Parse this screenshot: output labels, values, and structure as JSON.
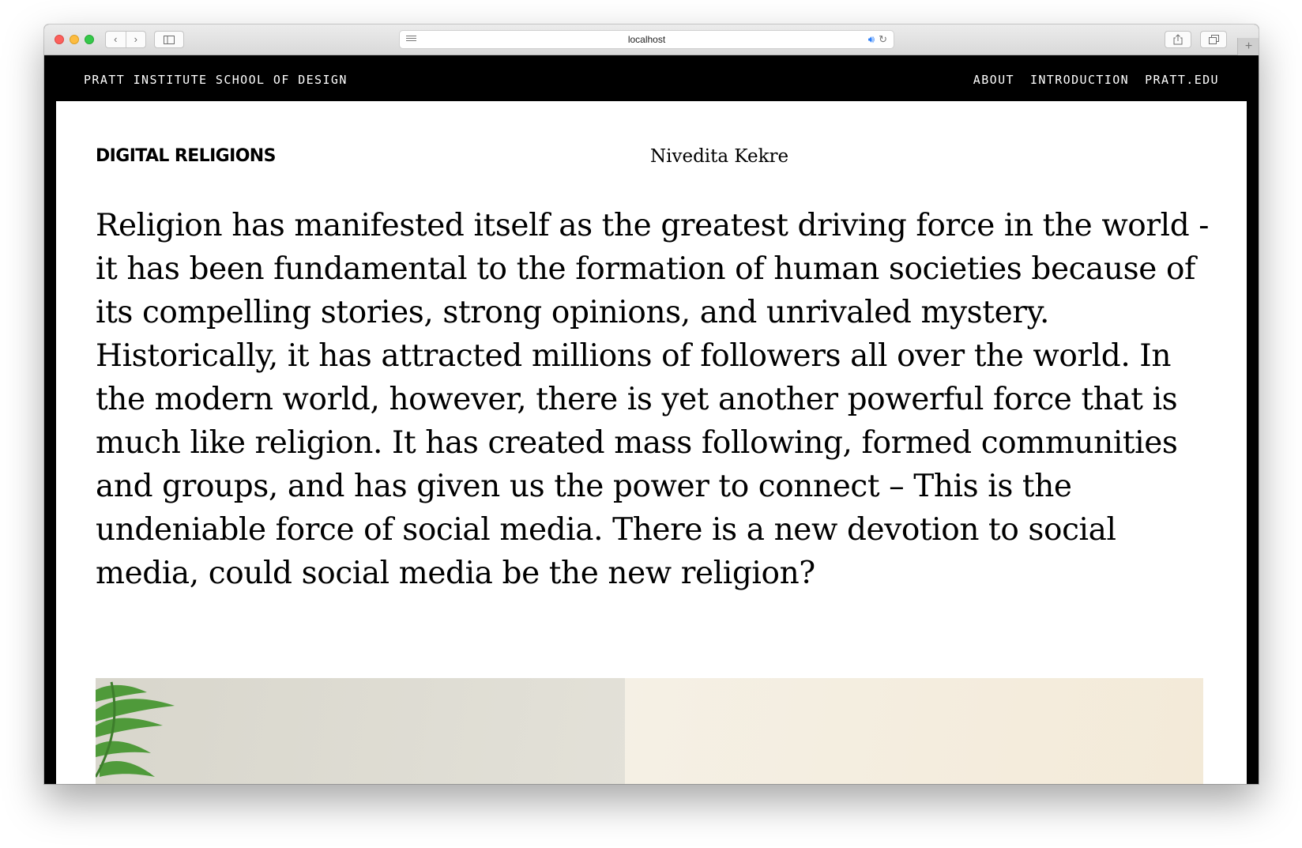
{
  "browser": {
    "url": "localhost",
    "icons": {
      "back": "chevron-left-icon",
      "forward": "chevron-right-icon",
      "sidebar": "sidebar-icon",
      "reader": "reader-icon",
      "audio": "speaker-icon",
      "reload": "reload-icon",
      "share": "share-icon",
      "tabs": "tabs-icon",
      "new_tab": "plus-icon"
    }
  },
  "header": {
    "site_title": "PRATT INSTITUTE SCHOOL OF DESIGN",
    "nav": [
      {
        "label": "ABOUT"
      },
      {
        "label": "INTRODUCTION"
      },
      {
        "label": "PRATT.EDU"
      }
    ]
  },
  "project": {
    "title": "DIGITAL RELIGIONS",
    "author": "Nivedita Kekre",
    "intro": "Religion has manifested itself as the greatest driving force in the world - it has been fundamental to the formation of human societies because of its compelling stories, strong opinions, and unrivaled mystery. Historically, it has attracted millions of followers all over the world. In the modern world, however, there is yet another powerful force that is much like religion. It has created mass following, formed communities and groups, and has given us the power to connect – This is the undeniable force of social media. There is a new devotion to social media, could social media be the new religion?"
  },
  "colors": {
    "nav_background": "#000000",
    "page_background": "#ffffff",
    "text": "#000000",
    "hero_left": "#dcdad1",
    "hero_right": "#f4eddf",
    "plant": "#4f9a3a"
  }
}
